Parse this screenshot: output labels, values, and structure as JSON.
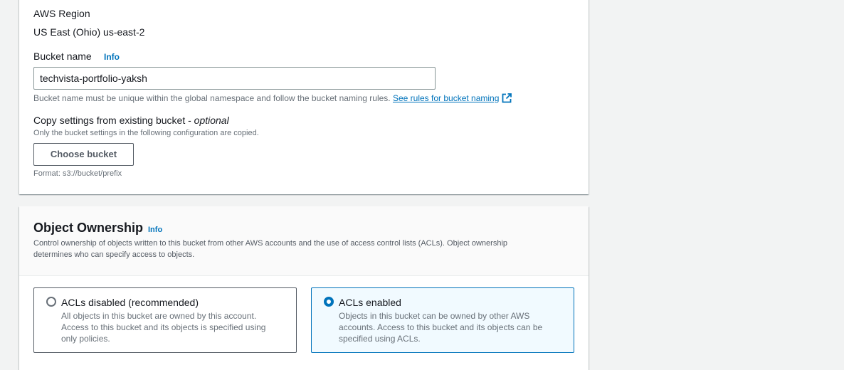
{
  "general": {
    "region_label": "AWS Region",
    "region_value": "US East (Ohio) us-east-2",
    "bucket_name_label": "Bucket name",
    "info": "Info",
    "bucket_name_value": "techvista-portfolio-yaksh",
    "bucket_name_hint": "Bucket name must be unique within the global namespace and follow the bucket naming rules.",
    "bucket_name_rules_link": "See rules for bucket naming",
    "copy_settings_label": "Copy settings from existing bucket - ",
    "copy_settings_optional": "optional",
    "copy_settings_desc": "Only the bucket settings in the following configuration are copied.",
    "choose_bucket_button": "Choose bucket",
    "format_hint": "Format: s3://bucket/prefix"
  },
  "ownership": {
    "title": "Object Ownership",
    "info": "Info",
    "description_line1": "Control ownership of objects written to this bucket from other AWS accounts and the use of access control lists (ACLs). Object ownership",
    "description_line2": "determines who can specify access to objects.",
    "options": [
      {
        "title": "ACLs disabled (recommended)",
        "description": "All objects in this bucket are owned by this account. Access to this bucket and its objects is specified using only policies.",
        "selected": false
      },
      {
        "title": "ACLs enabled",
        "description": "Objects in this bucket can be owned by other AWS accounts. Access to this bucket and its objects can be specified using ACLs.",
        "selected": true
      }
    ]
  },
  "colors": {
    "link": "#0073bb",
    "page_bg": "#f2f3f3",
    "selected_tile_bg": "#f1faff"
  }
}
